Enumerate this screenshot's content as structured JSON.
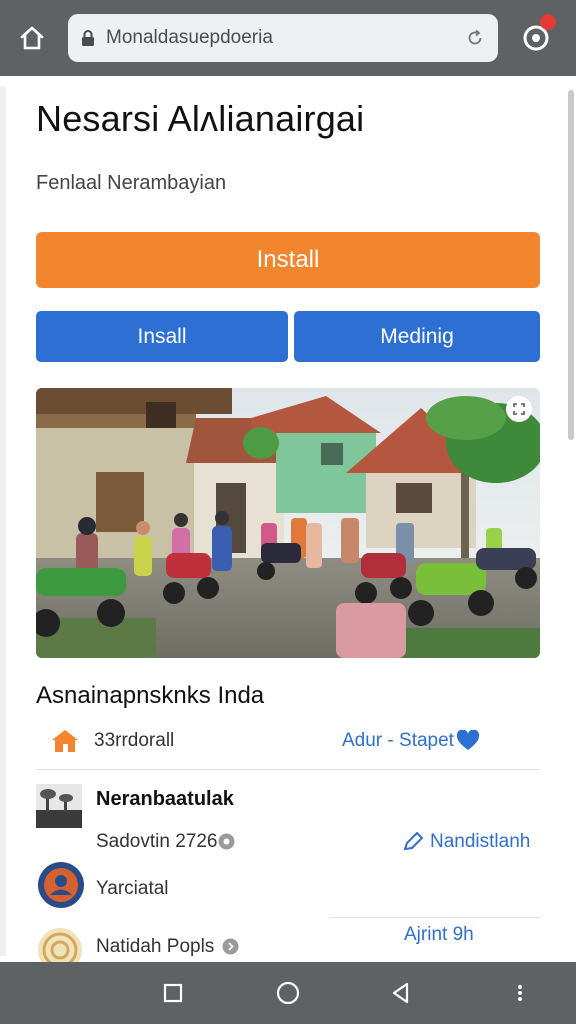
{
  "browser": {
    "url": "Monaldasuepdoeria",
    "home_icon": "home-icon",
    "lock_icon": "lock-icon",
    "reload_icon": "reload-icon",
    "menu_icon": "menu-icon",
    "notification_color": "#e53935"
  },
  "page": {
    "title": "Nesarsi Alʌlianairgai",
    "subtitle": "Fenlaal Nerambayian",
    "primary_button": "Install",
    "secondary_button_1": "Insall",
    "secondary_button_2": "Medinig",
    "accent_orange": "#f2852d",
    "accent_blue": "#2e6fd4"
  },
  "section": {
    "title": "Asnainapnsknks Inda",
    "rows": [
      {
        "icon": "house-icon",
        "label": "33rrdorall",
        "link": "Adur - Stapet",
        "link_icon": "heart-icon"
      },
      {
        "icon": "thumbnail-image",
        "name": "Neranbaatulak",
        "meta": "Sadovtin 2726",
        "meta_icon": "info-icon",
        "link": "Nandistlanh",
        "link_icon": "pencil-icon"
      },
      {
        "icon": "avatar-image",
        "name": "Yarciatal"
      },
      {
        "icon": "badge-image",
        "name": "Natidah Popls",
        "name_icon": "chevron-right-icon",
        "link": "Ajrint 9h"
      }
    ]
  },
  "navigation": {
    "recents_icon": "square-icon",
    "home_icon": "circle-home-icon",
    "back_icon": "back-triangle-icon",
    "more_icon": "more-dots-icon"
  }
}
